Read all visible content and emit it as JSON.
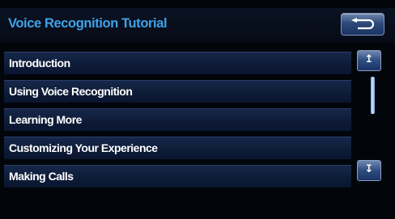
{
  "header": {
    "title": "Voice Recognition Tutorial",
    "back_icon": "return-arrow-icon"
  },
  "menu": {
    "items": [
      {
        "label": "Introduction"
      },
      {
        "label": "Using Voice Recognition"
      },
      {
        "label": "Learning More"
      },
      {
        "label": "Customizing Your Experience"
      },
      {
        "label": "Making Calls"
      }
    ]
  },
  "scrollbar": {
    "up_icon": "scroll-up-arrow-icon",
    "down_icon": "scroll-down-arrow-icon",
    "up_glyph": "↥",
    "down_glyph": "↧"
  },
  "colors": {
    "title": "#3fa2e8",
    "row_bg": "#0e1c38",
    "button_bg": "#2f4d80",
    "scroll_thumb": "#cfe2ff"
  }
}
